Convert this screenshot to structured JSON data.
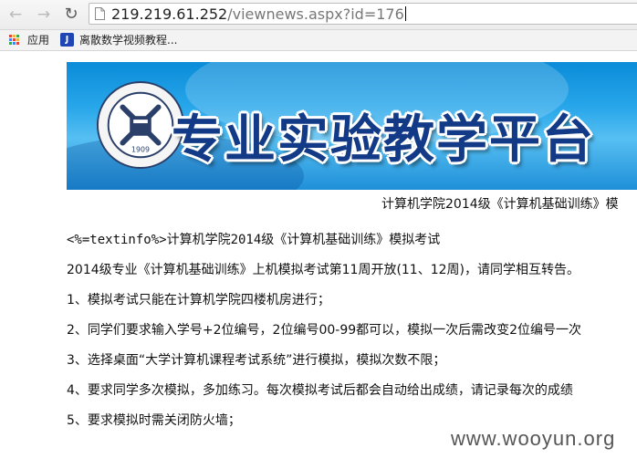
{
  "browser": {
    "back_icon": "back-arrow-icon",
    "forward_icon": "forward-arrow-icon",
    "reload_icon": "reload-icon",
    "url_host": "219.219.61.252",
    "url_path": "/viewnews.aspx?id=176"
  },
  "bookmarks": {
    "apps_label": "应用",
    "item_label": "离散数学视频教程..."
  },
  "banner": {
    "title": "专业实验教学平台",
    "emblem_year": "1909"
  },
  "news": {
    "heading": "计算机学院2014级《计算机基础训练》模",
    "lines": [
      "<%=textinfo%>计算机学院2014级《计算机基础训练》模拟考试",
      "2014级专业《计算机基础训练》上机模拟考试第11周开放(11、12周)，请同学相互转告。",
      "1、模拟考试只能在计算机学院四楼机房进行；",
      "2、同学们要求输入学号+2位编号，2位编号00-99都可以，模拟一次后需改变2位编号一次",
      "3、选择桌面“大学计算机课程考试系统”进行模拟，模拟次数不限；",
      "4、要求同学多次模拟，多加练习。每次模拟考试后都会自动给出成绩，请记录每次的成绩",
      "5、要求模拟时需关闭防火墙；"
    ]
  },
  "watermark": "www.wooyun.org",
  "colors": {
    "banner_blue": "#27a6ea",
    "title_navy": "#123a86"
  }
}
